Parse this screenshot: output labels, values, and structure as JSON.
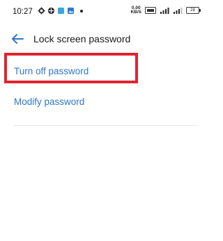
{
  "statusbar": {
    "time": "10:27",
    "net_speed_value": "0.00",
    "net_speed_unit": "KB/S",
    "battery_level": "28"
  },
  "header": {
    "title": "Lock screen password"
  },
  "options": [
    {
      "label": "Turn off password"
    },
    {
      "label": "Modify password"
    }
  ],
  "colors": {
    "accent": "#2f76c9",
    "highlight": "#e02430"
  }
}
